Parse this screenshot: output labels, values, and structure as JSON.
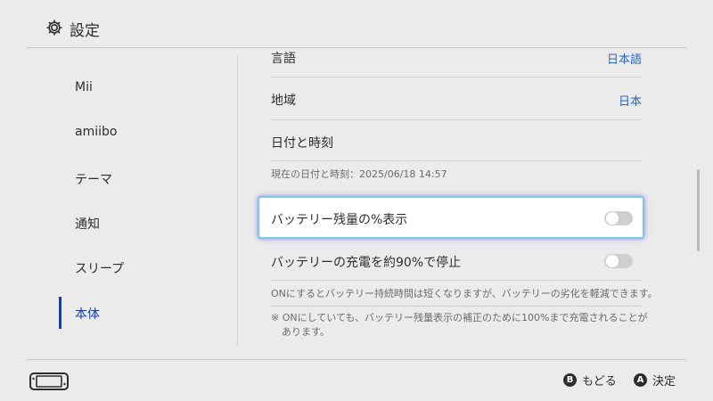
{
  "header": {
    "title": "設定",
    "icon": "gear-icon"
  },
  "sidebar": {
    "items": [
      {
        "label": "Mii"
      },
      {
        "label": "amiibo"
      },
      {
        "label": "テーマ"
      },
      {
        "label": "通知"
      },
      {
        "label": "スリープ"
      },
      {
        "label": "本体"
      }
    ],
    "active_index": 5,
    "accent_color": "#1d3f9a"
  },
  "content": {
    "language": {
      "label": "言語",
      "value": "日本語"
    },
    "region": {
      "label": "地域",
      "value": "日本"
    },
    "datetime": {
      "label": "日付と時刻",
      "note": "現在の日付と時刻：2025/06/18 14:57"
    },
    "battery_percent": {
      "label": "バッテリー残量の%表示",
      "enabled": false
    },
    "battery_limit": {
      "label": "バッテリーの充電を約90%で停止",
      "enabled": false,
      "note": "ONにするとバッテリー持続時間は短くなりますが、バッテリーの劣化を軽減できます。",
      "note2_line1": "※ ONにしていても、バッテリー残量表示の補正のために100%まで充電されることが",
      "note2_line2": "あります。"
    },
    "value_color": "#2766c4"
  },
  "footer": {
    "back": {
      "button": "B",
      "label": "もどる"
    },
    "confirm": {
      "button": "A",
      "label": "決定"
    },
    "console_icon": "switch-console-icon"
  }
}
